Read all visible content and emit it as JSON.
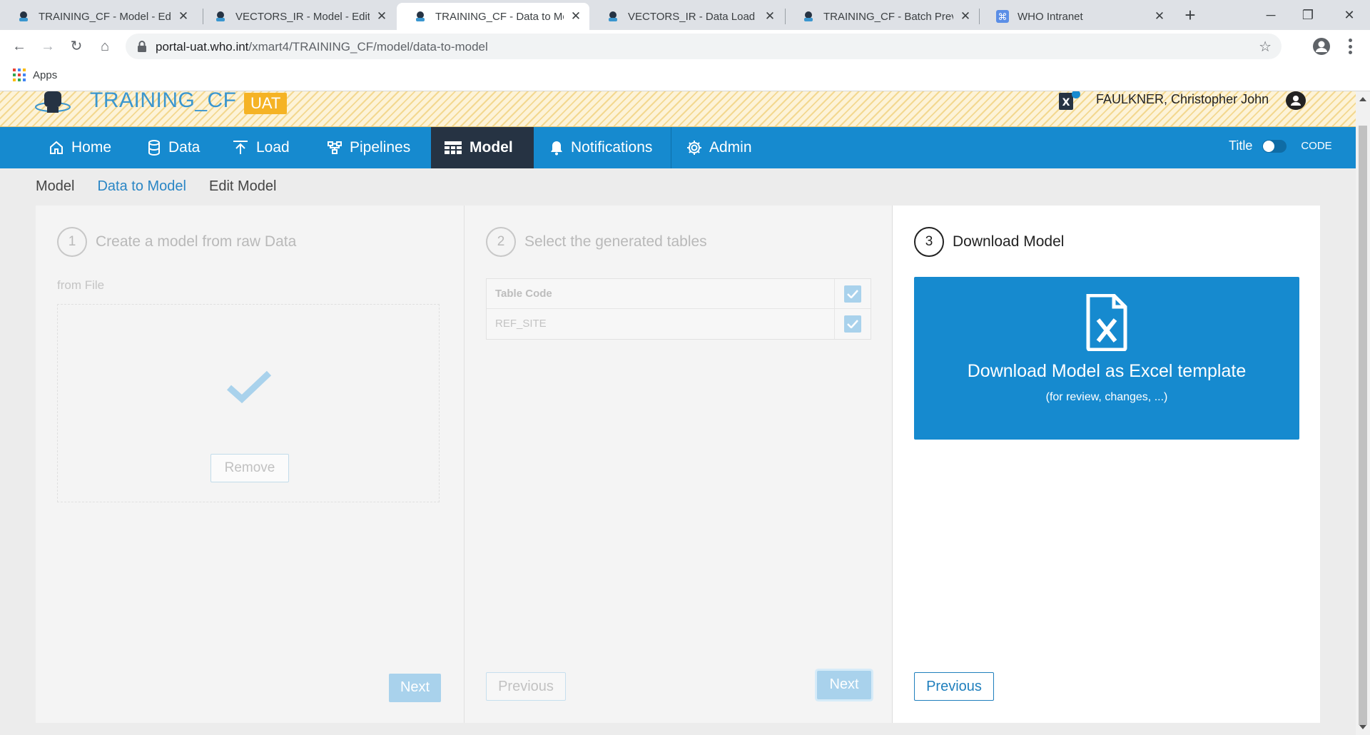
{
  "browser": {
    "tabs": [
      {
        "title": "TRAINING_CF - Model - Edit",
        "active": false
      },
      {
        "title": "VECTORS_IR - Model - Edit",
        "active": false
      },
      {
        "title": "TRAINING_CF - Data to Model",
        "active": true
      },
      {
        "title": "VECTORS_IR - Data Load",
        "active": false
      },
      {
        "title": "TRAINING_CF - Batch Preview",
        "active": false
      },
      {
        "title": "WHO Intranet",
        "active": false
      }
    ],
    "url_host": "portal-uat.who.int",
    "url_path": "/xmart4/TRAINING_CF/model/data-to-model",
    "bookmarks": {
      "apps_label": "Apps"
    }
  },
  "header": {
    "app_name": "TRAINING_CF",
    "env_badge": "UAT",
    "user_name": "FAULKNER, Christopher John"
  },
  "nav": {
    "items": [
      {
        "label": "Home",
        "icon": "home-icon"
      },
      {
        "label": "Data",
        "icon": "database-icon"
      },
      {
        "label": "Load",
        "icon": "upload-icon"
      },
      {
        "label": "Pipelines",
        "icon": "pipelines-icon"
      },
      {
        "label": "Model",
        "icon": "table-icon",
        "active": true
      },
      {
        "label": "Notifications",
        "icon": "bell-icon"
      },
      {
        "label": "Admin",
        "icon": "gear-icon"
      }
    ],
    "toggle_left": "Title",
    "toggle_right": "CODE"
  },
  "subnav": {
    "items": [
      "Model",
      "Data to Model",
      "Edit Model"
    ],
    "current": "Data to Model"
  },
  "step1": {
    "number": "1",
    "title": "Create a model from raw Data",
    "source_label": "from File",
    "remove_label": "Remove",
    "next_label": "Next"
  },
  "step2": {
    "number": "2",
    "title": "Select the generated tables",
    "table_header": "Table Code",
    "rows": [
      "REF_SITE"
    ],
    "previous_label": "Previous",
    "next_label": "Next"
  },
  "step3": {
    "number": "3",
    "title": "Download Model",
    "download_label": "Download Model as Excel template",
    "download_sub": "(for review, changes, ...)",
    "previous_label": "Previous"
  },
  "colors": {
    "primary": "#168acf",
    "nav_active": "#263343",
    "badge": "#f5b325",
    "app_name": "#3a96cf"
  }
}
